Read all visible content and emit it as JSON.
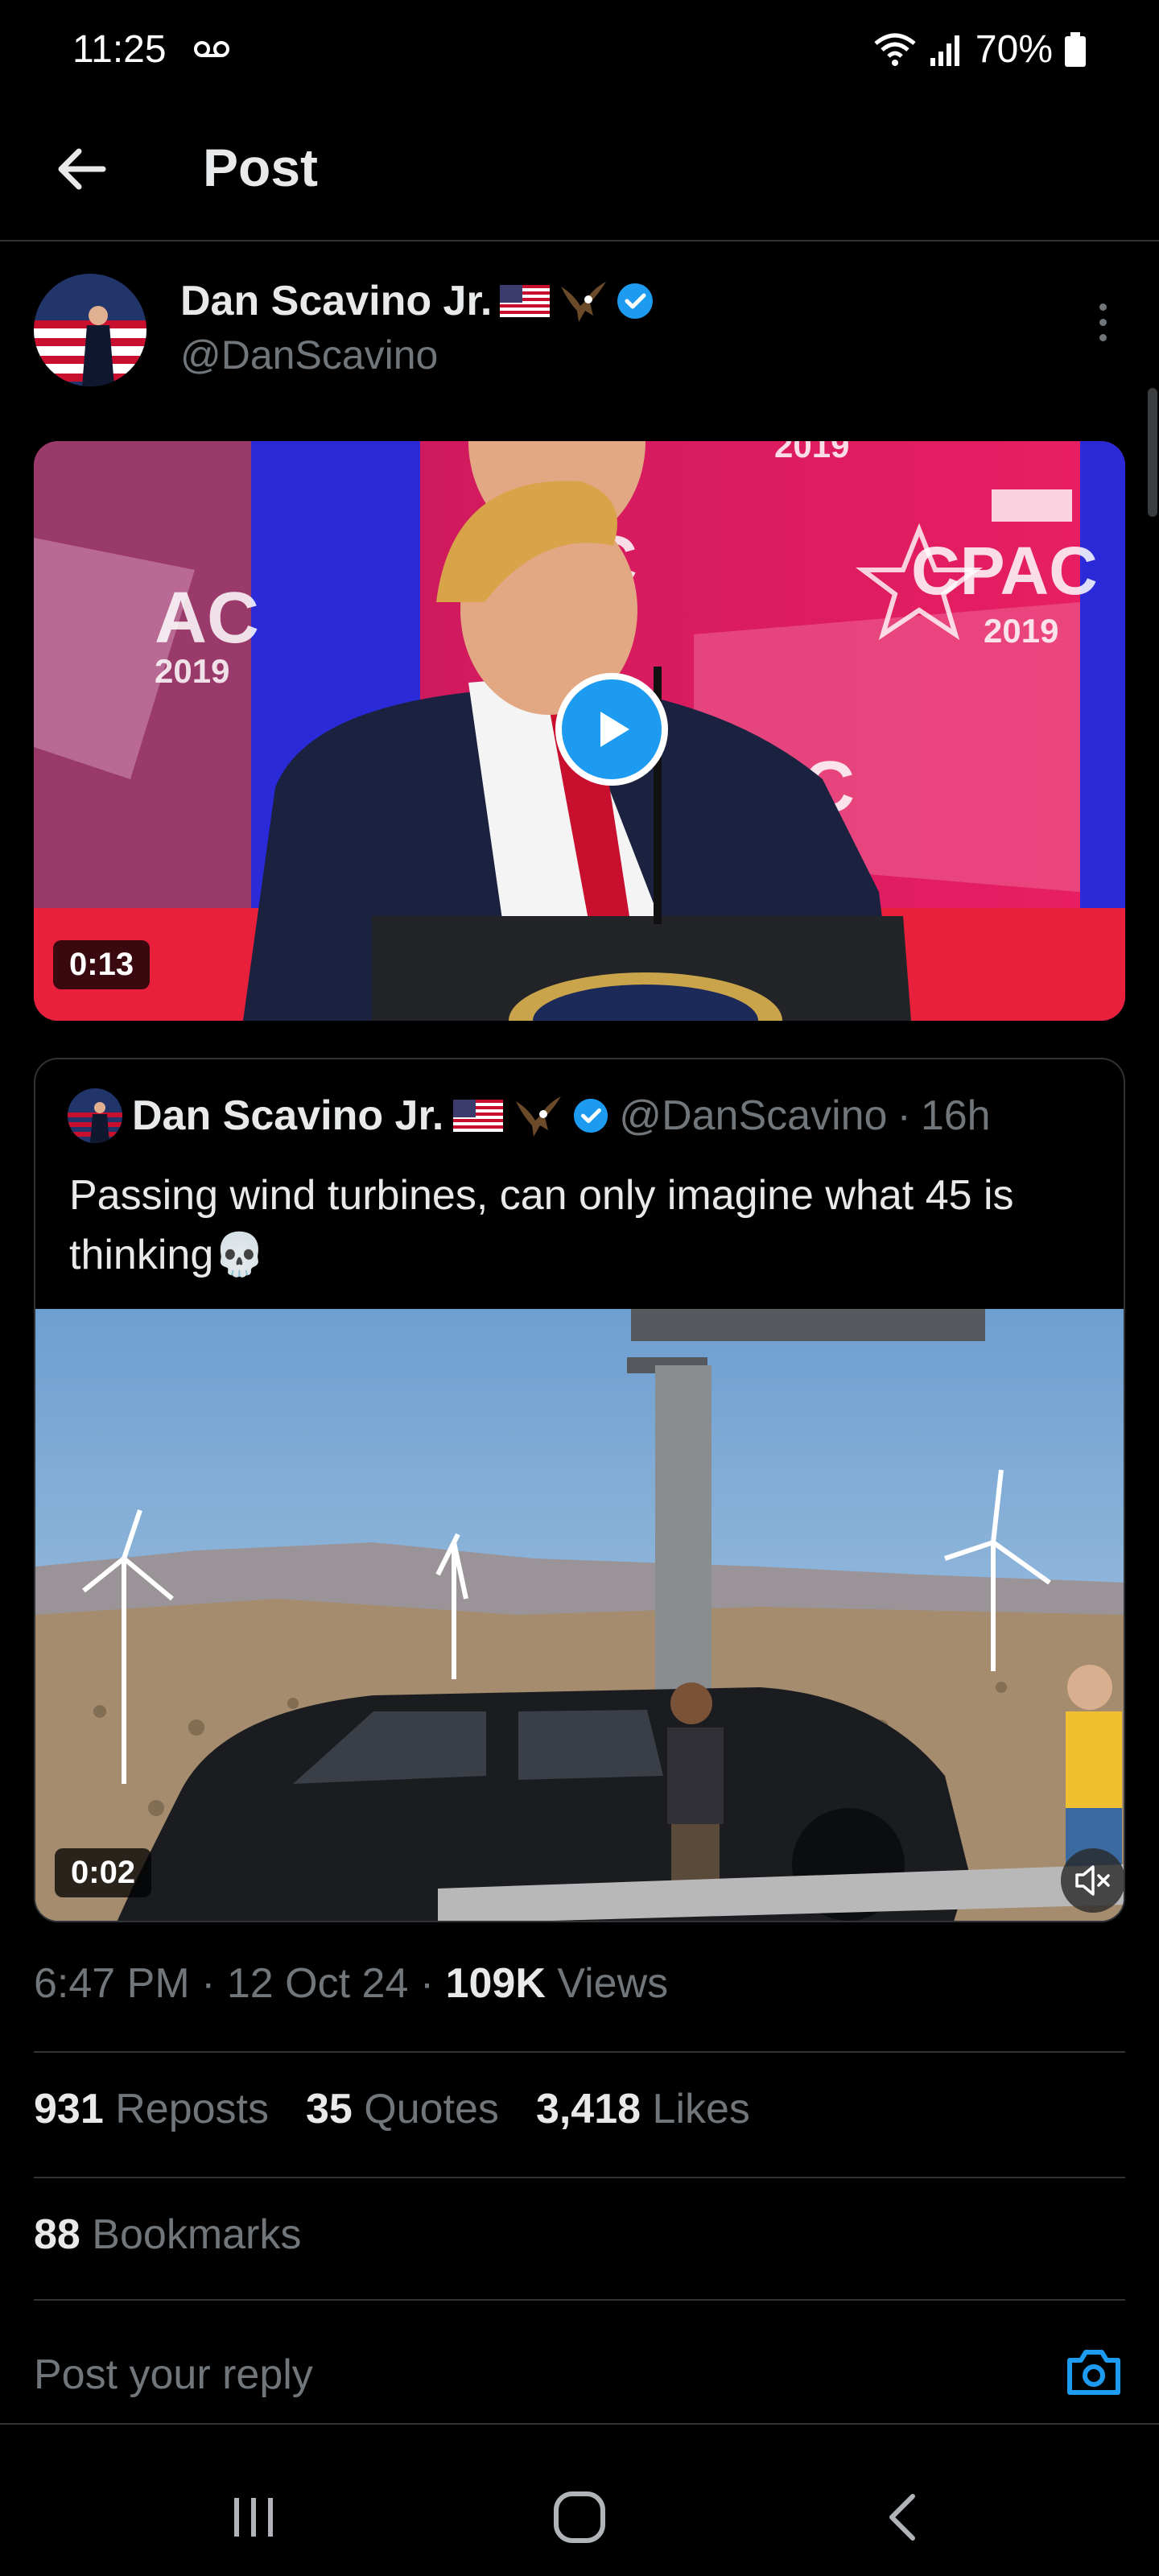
{
  "status_bar": {
    "time": "11:25",
    "battery": "70%"
  },
  "header": {
    "title": "Post"
  },
  "post": {
    "author_name": "Dan Scavino Jr.",
    "author_handle": "@DanScavino",
    "video_duration": "0:13"
  },
  "quoted_post": {
    "author_name": "Dan Scavino Jr.",
    "author_handle": "@DanScavino",
    "separator": "·",
    "time_ago": "16h",
    "text": "Passing wind turbines, can only imagine what 45 is thinking",
    "emoji": "💀",
    "video_duration": "0:02"
  },
  "meta": {
    "time": "6:47 PM",
    "separator": "·",
    "date": "12 Oct 24",
    "views_count": "109K",
    "views_label": "Views"
  },
  "stats": {
    "reposts_count": "931",
    "reposts_label": "Reposts",
    "quotes_count": "35",
    "quotes_label": "Quotes",
    "likes_count": "3,418",
    "likes_label": "Likes",
    "bookmarks_count": "88",
    "bookmarks_label": "Bookmarks"
  },
  "reply": {
    "placeholder": "Post your reply"
  },
  "colors": {
    "accent": "#1d9bf0",
    "background": "#000000",
    "text_primary": "#e7e9ea",
    "text_secondary": "#71767b",
    "divider": "#2f3336"
  }
}
